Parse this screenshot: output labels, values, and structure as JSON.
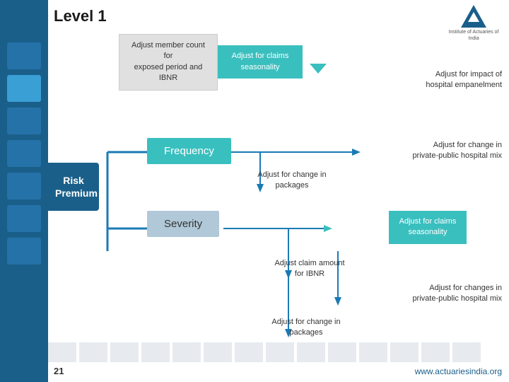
{
  "page": {
    "title": "Level 1",
    "number": "21"
  },
  "logo": {
    "text": "Institute of Actuaries of India"
  },
  "top_row": {
    "member_count_box": "Adjust member count for\nexposed period and IBNR",
    "claims_seasonality_box": "Adjust for claims\nseasonality"
  },
  "impact_box": "Adjust for impact of\nhospital empanelment",
  "risk_premium": "Risk\nPremium",
  "frequency": {
    "label": "Frequency",
    "private_pub": "Adjust for change in\nprivate-public hospital mix",
    "packages": "Adjust for change in\npackages"
  },
  "severity": {
    "label": "Severity",
    "seasonality": "Adjust for claims\nseasonality",
    "ibnr": "Adjust claim amount\nfor IBNR",
    "private_pub": "Adjust for changes in\nprivate-public hospital mix",
    "packages": "Adjust for change in\npackages"
  },
  "website": "www.actuariesindia.org"
}
